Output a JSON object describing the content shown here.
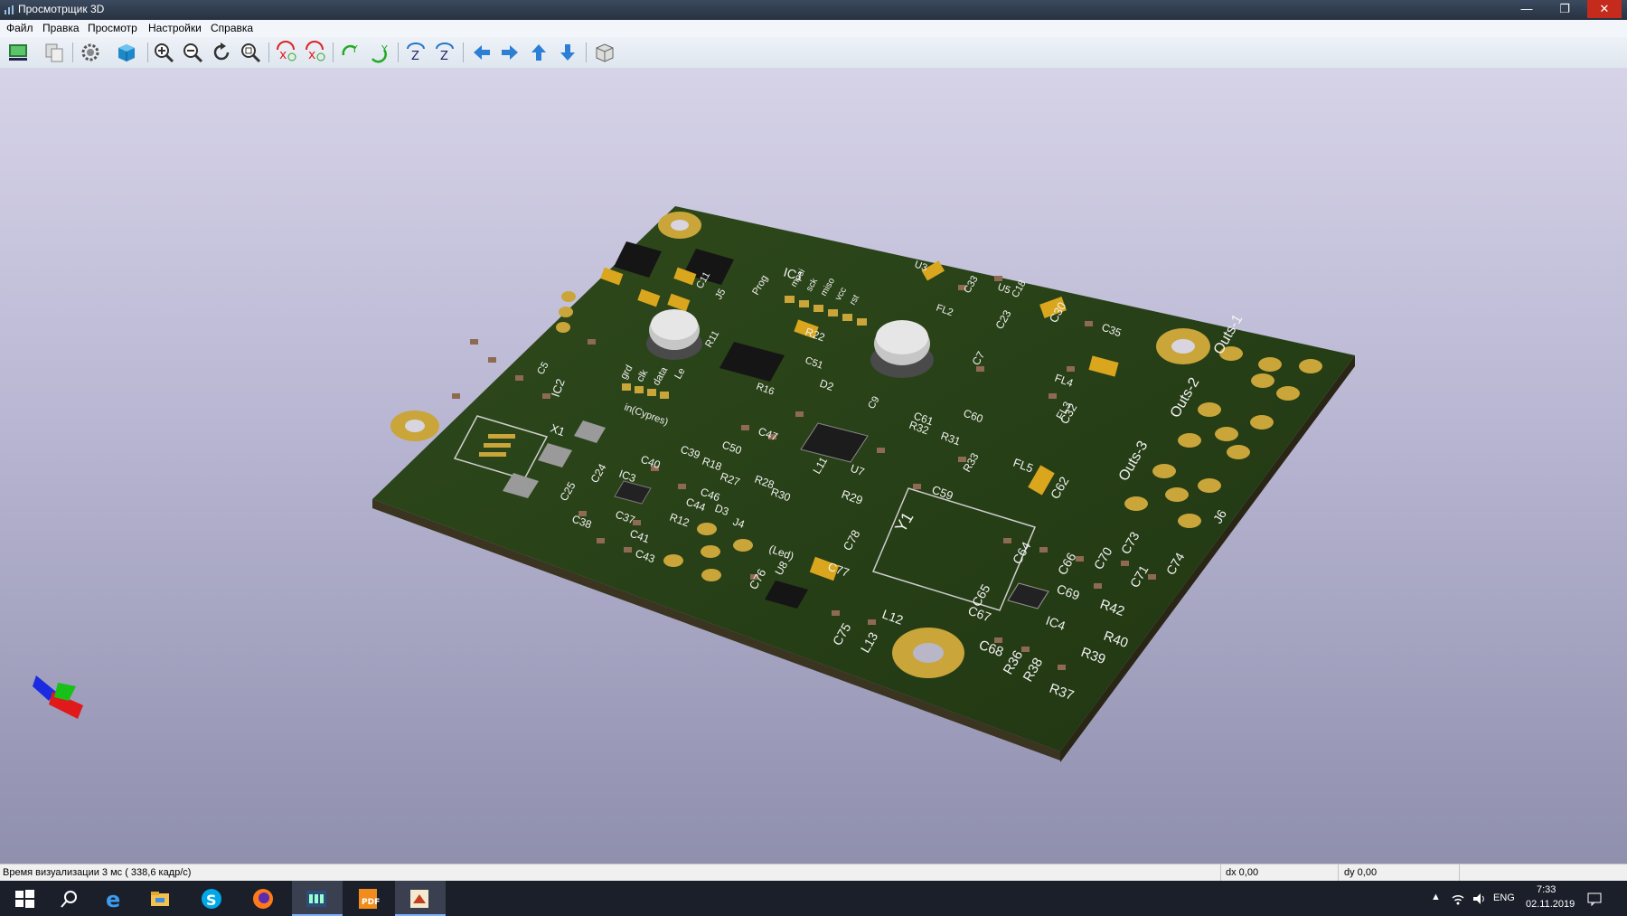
{
  "window": {
    "title": "Просмотрщик 3D",
    "minimize": "—",
    "maximize": "❐",
    "close": "✕"
  },
  "menu": {
    "items": [
      "Файл",
      "Правка",
      "Просмотр",
      "Настройки",
      "Справка"
    ]
  },
  "toolbar": {
    "buttons": [
      "export-image",
      "copy-clipboard",
      "render-settings",
      "reload-board",
      "zoom-in",
      "zoom-out",
      "redraw",
      "zoom-fit",
      "rotate-x-cw",
      "rotate-x-ccw",
      "rotate-y-cw",
      "rotate-y-ccw",
      "rotate-z-cw",
      "rotate-z-ccw",
      "move-left",
      "move-right",
      "move-up",
      "move-down",
      "orthographic-toggle"
    ]
  },
  "pcb": {
    "labels": {
      "ic1": "IC1",
      "ic2": "IC2",
      "ic3": "IC3",
      "ic4": "IC4",
      "u1": "U1",
      "u3": "U3",
      "u5": "U5",
      "u7": "U7",
      "u8": "U8",
      "x1": "X1",
      "y1": "Y1",
      "d2": "D2",
      "d3": "D3",
      "j4": "J4",
      "j5": "J5",
      "j6": "J6",
      "fl2": "FL2",
      "fl3": "FL3",
      "fl4": "FL4",
      "fl5": "FL5",
      "outs1": "Outs-1",
      "outs2": "Outs-2",
      "outs3": "Outs-3",
      "led": "(Led)",
      "in_cypress": "in(Cypres)",
      "c30": "C30",
      "c35": "C35",
      "c32": "C32",
      "c33": "C33",
      "c22": "C22",
      "c23": "C23",
      "c59": "C59",
      "c60": "C60",
      "c61": "C61",
      "c62": "C62",
      "c64": "C64",
      "c65": "C65",
      "c66": "C66",
      "c67": "C67",
      "c68": "C68",
      "c69": "C69",
      "c70": "C70",
      "c71": "C71",
      "c73": "C73",
      "c74": "C74",
      "c75": "C75",
      "c76": "C76",
      "c77": "C77",
      "c78": "C78",
      "c37": "C37",
      "c38": "C38",
      "c39": "C39",
      "c40": "C40",
      "c41": "C41",
      "c43": "C43",
      "c44": "C44",
      "c46": "C46",
      "c47": "C47",
      "c50": "C50",
      "c51": "C51",
      "c24": "C24",
      "c25": "C25",
      "c7": "C7",
      "c9": "C9",
      "c11": "C11",
      "c18": "C18",
      "c5": "C5",
      "r12": "R12",
      "r18": "R18",
      "r22": "R22",
      "r27": "R27",
      "r28": "R28",
      "r29": "R29",
      "r30": "R30",
      "r31": "R31",
      "r32": "R32",
      "r33": "R33",
      "r36": "R36",
      "r37": "R37",
      "r38": "R38",
      "r39": "R39",
      "r40": "R40",
      "r42": "R42",
      "r16": "R16",
      "r11": "R11",
      "l11": "L11",
      "l12": "L12",
      "l13": "L13",
      "pins_a": "grd",
      "pins_b": "clk",
      "pins_c": "data",
      "pins_d": "Le",
      "prog": "Prog",
      "mosi": "mosi",
      "sck": "sck",
      "miso": "miso",
      "rst": "rst",
      "vcc": "vcc"
    }
  },
  "status": {
    "render_time": "Время визуализации 3 мс ( 338,6 кадр/с)",
    "dx": "dx 0,00",
    "dy": "dy 0,00"
  },
  "taskbar": {
    "apps": [
      "start",
      "search",
      "edge",
      "explorer",
      "skype",
      "firefox",
      "kicad-pcbnew",
      "pdf-tool",
      "kicad-3d-viewer"
    ],
    "language": "ENG",
    "time": "7:33",
    "date": "02.11.2019"
  }
}
